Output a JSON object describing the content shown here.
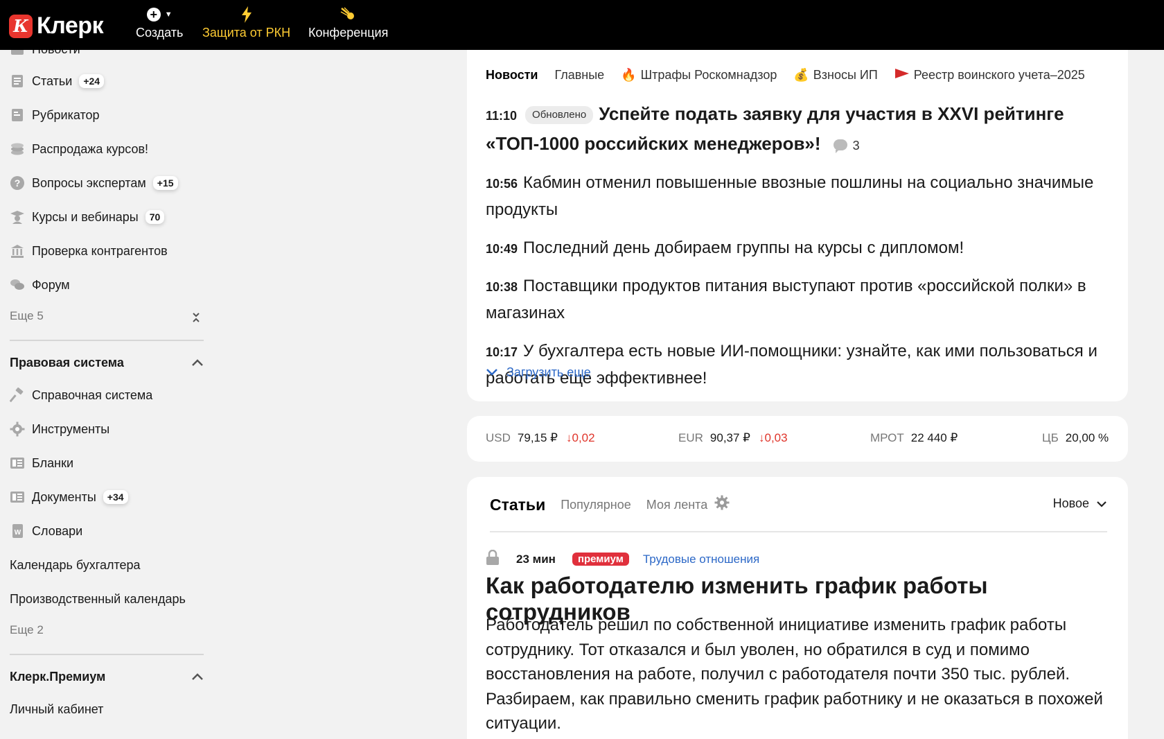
{
  "header": {
    "logo_badge": "К",
    "logo_text": "Клерк",
    "nav": [
      {
        "label": "Создать",
        "icon": "plus-circle-icon"
      },
      {
        "label": "Защита от РКН",
        "icon": "lightning-icon"
      },
      {
        "label": "Конференция",
        "icon": "comet-icon"
      }
    ],
    "accent_color": "#ffcc33"
  },
  "sidebar": {
    "top_cut_label": "Новости",
    "items": [
      {
        "label": "Статьи",
        "badge": "+24",
        "icon": "articles-icon"
      },
      {
        "label": "Рубрикатор",
        "badge": "",
        "icon": "rubricator-icon"
      },
      {
        "label": "Распродажа курсов!",
        "badge": "",
        "icon": "coins-icon"
      },
      {
        "label": "Вопросы экспертам",
        "badge": "+15",
        "icon": "question-icon"
      },
      {
        "label": "Курсы и вебинары",
        "badge": "70",
        "icon": "graduate-icon"
      },
      {
        "label": "Проверка контрагентов",
        "badge": "",
        "icon": "bank-icon"
      },
      {
        "label": "Форум",
        "badge": "",
        "icon": "forum-icon"
      }
    ],
    "more1": "Еще 5",
    "section_legal": "Правовая система",
    "legal_items": [
      {
        "label": "Справочная система",
        "badge": "",
        "icon": "hammer-icon"
      },
      {
        "label": "Инструменты",
        "badge": "",
        "icon": "gear-icon"
      },
      {
        "label": "Бланки",
        "badge": "",
        "icon": "forms-icon"
      },
      {
        "label": "Документы",
        "badge": "+34",
        "icon": "documents-icon"
      },
      {
        "label": "Словари",
        "badge": "",
        "icon": "dictionary-icon"
      },
      {
        "label": "Календарь бухгалтера",
        "badge": "",
        "icon": ""
      },
      {
        "label": "Производственный календарь",
        "badge": "",
        "icon": ""
      }
    ],
    "more2": "Еще 2",
    "section_premium": "Клерк.Премиум",
    "premium_items": [
      {
        "label": "Личный кабинет"
      }
    ]
  },
  "news": {
    "tabs": [
      {
        "label": "Новости",
        "icon": ""
      },
      {
        "label": "Главные",
        "icon": ""
      },
      {
        "label": "Штрафы Роскомнадзор",
        "icon": "🔥"
      },
      {
        "label": "Взносы ИП",
        "icon": "💰"
      },
      {
        "label": "Реестр воинского учета–2025",
        "icon": "flag"
      }
    ],
    "items": [
      {
        "time": "11:10",
        "updated": "Обновлено",
        "title": "Успейте подать заявку для участия в XXVI рейтинге «ТОП-1000 российских менеджеров»!",
        "comments": "3"
      },
      {
        "time": "10:56",
        "title": "Кабмин отменил повышенные ввозные пошлины на социально значимые продукты"
      },
      {
        "time": "10:49",
        "title": "Последний день добираем группы на курсы с дипломом!"
      },
      {
        "time": "10:38",
        "title": "Поставщики продуктов питания выступают против «российской полки» в магазинах"
      },
      {
        "time": "10:17",
        "title": "У бухгалтера есть новые ИИ-помощники: узнайте, как ими пользоваться и работать еще эффективнее!"
      }
    ],
    "load_more": "Загрузить еще"
  },
  "rates": [
    {
      "key": "USD",
      "value": "79,15 ₽",
      "delta": "↓0,02"
    },
    {
      "key": "EUR",
      "value": "90,37 ₽",
      "delta": "↓0,03"
    },
    {
      "key": "МРОТ",
      "value": "22 440 ₽",
      "delta": ""
    },
    {
      "key": "ЦБ",
      "value": "20,00 %",
      "delta": ""
    }
  ],
  "articles": {
    "tabs": [
      "Статьи",
      "Популярное",
      "Моя лента"
    ],
    "sort_label": "Новое",
    "article": {
      "read_time": "23 мин",
      "premium_label": "премиум",
      "rubric": "Трудовые отношения",
      "title": "Как работодателю изменить график работы сотрудников",
      "text": "Работодатель решил по собственной инициативе изменить график работы сотруднику. Тот отказался и был уволен, но обратился в суд и помимо восстановления на работе, получил с работодателя почти 350 тыс. рублей. Разбираем, как правильно сменить график работнику и не оказаться в похожей ситуации."
    }
  }
}
